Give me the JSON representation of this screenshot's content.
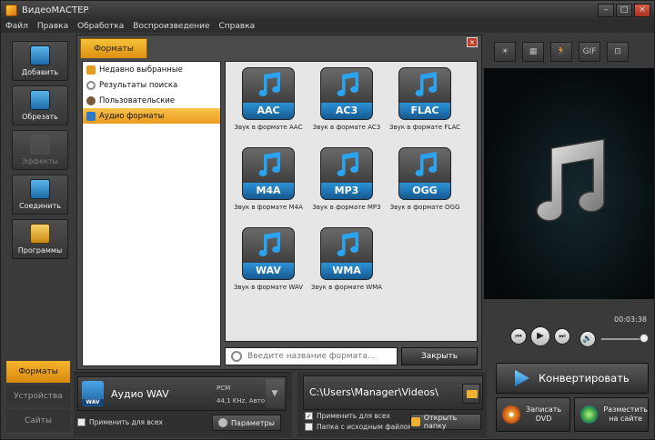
{
  "window": {
    "title": "ВидеоМАСТЕР",
    "minimize": "–",
    "maximize": "□",
    "close": "×"
  },
  "menu": [
    "Файл",
    "Правка",
    "Обработка",
    "Воспроизведение",
    "Справка"
  ],
  "left_tools": [
    {
      "label": "Добавить",
      "icon": "film-add-icon",
      "color": "#3fa04a"
    },
    {
      "label": "Обрезать",
      "icon": "film-cut-icon",
      "color": "#3a7bc8"
    },
    {
      "label": "Эффекты",
      "icon": "effects-icon",
      "color": "#556655",
      "disabled": true
    },
    {
      "label": "Соединить",
      "icon": "film-join-icon",
      "color": "#3a7bc8"
    },
    {
      "label": "Программы",
      "icon": "programs-icon",
      "color": "#d4a020"
    }
  ],
  "left_tabs": [
    "Форматы",
    "Устройства",
    "Сайты"
  ],
  "dialog": {
    "tab": "Форматы",
    "close": "×",
    "categories": [
      {
        "label": "Недавно выбранные",
        "icon": "recent-icon",
        "color": "#e59a1a"
      },
      {
        "label": "Результаты поиска",
        "icon": "search-icon",
        "color": "#888888"
      },
      {
        "label": "Пользовательские",
        "icon": "user-icon",
        "color": "#7a5a3a"
      },
      {
        "label": "Аудио форматы",
        "icon": "music-note-icon",
        "color": "#2a7ac8",
        "selected": true
      }
    ],
    "formats": [
      {
        "code": "AAC",
        "caption": "Звук в формате AAC"
      },
      {
        "code": "AC3",
        "caption": "Звук в формате AC3"
      },
      {
        "code": "FLAC",
        "caption": "Звук в формате FLAC"
      },
      {
        "code": "M4A",
        "caption": "Звук в формате M4A"
      },
      {
        "code": "MP3",
        "caption": "Звук в формате MP3"
      },
      {
        "code": "OGG",
        "caption": "Звук в формате OGG"
      },
      {
        "code": "WAV",
        "caption": "Звук в формате WAV"
      },
      {
        "code": "WMA",
        "caption": "Звук в формате WMA"
      }
    ],
    "search_placeholder": "Введите название формата...",
    "close_label": "Закрыть"
  },
  "preview": {
    "time": "00:03:38"
  },
  "player": {
    "prev": "⏮",
    "play": "▶",
    "next": "⏭",
    "volume": "🔊"
  },
  "format_panel": {
    "name": "Аудио WAV",
    "badge": "WAV",
    "detail1": "PCM",
    "detail2": "44,1 KHz, Авто",
    "arrow": "▼",
    "apply_all": "Применить для всех",
    "params": "Параметры"
  },
  "path_panel": {
    "path": "C:\\Users\\Manager\\Videos\\",
    "apply_all": "Применить для всех",
    "source_folder": "Папка с исходным файлом",
    "open_folder": "Открыть папку",
    "checkmark": "✓"
  },
  "actions": {
    "convert": "Конвертировать",
    "dvd_line1": "Записать",
    "dvd_line2": "DVD",
    "site_line1": "Разместить",
    "site_line2": "на сайте"
  },
  "preview_tools": [
    "☀",
    "▦",
    "🏃",
    "GIF",
    "⊡"
  ]
}
